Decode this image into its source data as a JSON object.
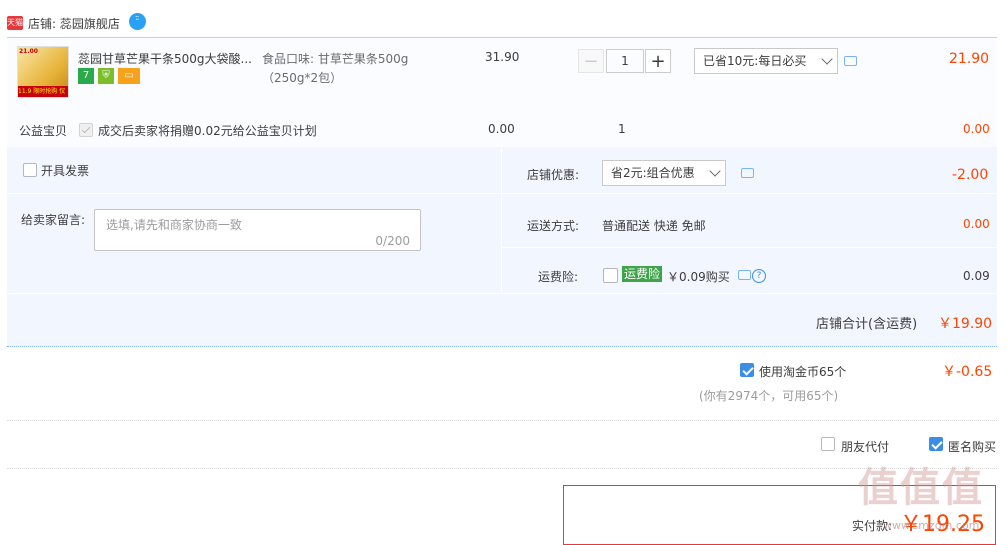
{
  "shop": {
    "badge": "天猫",
    "label": "店铺: 蕊园旗舰店"
  },
  "item": {
    "thumb_top": "21.00",
    "thumb_promo": "11.9 限时抢购 仅此一天",
    "title": "蕊园甘草芒果干条500g大袋酸...",
    "attr": "食品口味: 甘草芒果条500g（250g*2包）",
    "price": "31.90",
    "quantity": "1",
    "discount": "已省10元:每日必买",
    "subtotal": "21.90",
    "service_icons": [
      "seven-day-icon",
      "guarantee-icon",
      "card-icon"
    ]
  },
  "charity": {
    "label": "公益宝贝",
    "text": "成交后卖家将捐赠0.02元给公益宝贝计划",
    "price": "0.00",
    "qty": "1",
    "subtotal": "0.00"
  },
  "invoice": {
    "label": "开具发票"
  },
  "message": {
    "label": "给卖家留言:",
    "placeholder": "选填,请先和商家协商一致",
    "count": "0/200"
  },
  "shop_discount": {
    "label": "店铺优惠:",
    "value": "省2元:组合优惠",
    "amount": "-2.00"
  },
  "shipping": {
    "label": "运送方式:",
    "value": "普通配送 快递 免邮",
    "amount": "0.00"
  },
  "insurance": {
    "label": "运费险:",
    "pill": "运费险",
    "text": "￥0.09购买",
    "amount": "0.09"
  },
  "total": {
    "label": "店铺合计(含运费)",
    "amount": "￥19.90"
  },
  "coins": {
    "label": "使用淘金币65个",
    "note": "(你有2974个，可用65个)",
    "amount": "￥-0.65"
  },
  "options": {
    "friend_pay": "朋友代付",
    "anonymous": "匿名购买"
  },
  "payment": {
    "label": "实付款:",
    "amount": "￥19.25"
  },
  "watermark": "值值值",
  "watermark_url": "www.smzdm.com",
  "colors": {
    "accent": "#3a8ee6",
    "price_red": "#f40",
    "panel": "#f2f7ff",
    "border_red": "#e4393c"
  }
}
